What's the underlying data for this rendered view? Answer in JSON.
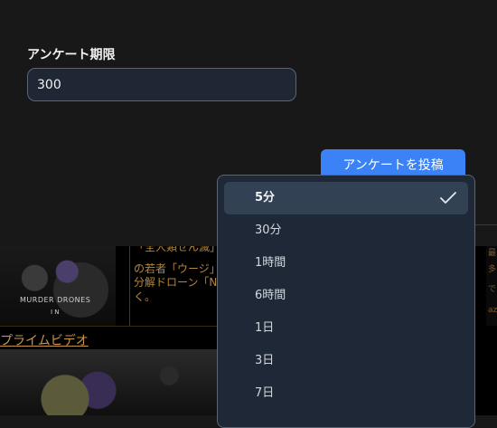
{
  "form": {
    "label": "アンケート期限",
    "value": "300",
    "post_button": "アンケートを投稿"
  },
  "dropdown": {
    "selected_icon": "check-icon",
    "options": [
      {
        "label": "5分",
        "selected": true
      },
      {
        "label": "30分",
        "selected": false
      },
      {
        "label": "1時間",
        "selected": false
      },
      {
        "label": "6時間",
        "selected": false
      },
      {
        "label": "1日",
        "selected": false
      },
      {
        "label": "3日",
        "selected": false
      },
      {
        "label": "7日",
        "selected": false
      }
    ]
  },
  "background": {
    "thumb_title": "MURDER DRONES",
    "thumb_sub": "I  N",
    "text_lines": [
      "「全人類せん滅」",
      "の若者「ウージ」",
      "分解ドローン「N",
      "く。"
    ],
    "link": "プライムビデオ",
    "right_glyphs": [
      "最",
      "多",
      "で",
      "az"
    ]
  },
  "colors": {
    "accent": "#3b82f6",
    "menu_bg": "#1e2836",
    "selected_bg": "#334155",
    "link": "#c9954a"
  }
}
